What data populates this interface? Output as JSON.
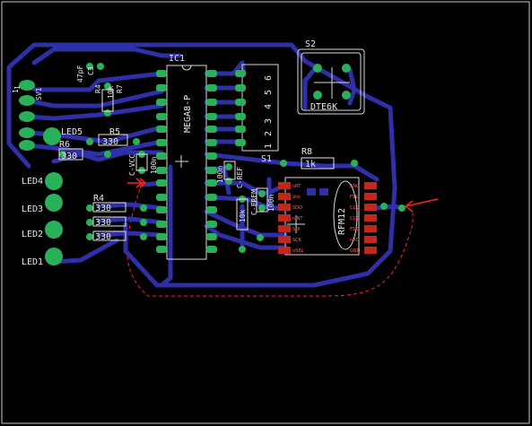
{
  "colors": {
    "background": "#000000",
    "outline": "#c8c8c8",
    "trace": "#2f2fa8",
    "pad": "#2bb05a",
    "silk": "#e6e6e6",
    "smd": "#c0281c",
    "marker": "#ff2020",
    "ratsnest": "#ff2020"
  },
  "labels": {
    "ic1": "IC1",
    "mega": "MEGA8-P",
    "sv1": "SV1",
    "cap47": "47pF",
    "c3": "C3",
    "r7": "R7",
    "r7v": "10k",
    "r4": "R4",
    "r4v": "R4",
    "led5": "LED5",
    "led4": "LED4",
    "led3": "LED3",
    "led2": "LED2",
    "led1": "LED1",
    "r6": "R6",
    "r6v": "330",
    "r5": "R5",
    "r5v": "330",
    "r3v": "330",
    "r2v": "330",
    "r1v": "330",
    "cvcc": "C-VCC",
    "c100n1": "100n",
    "c100n2": "100n",
    "c100n3": "100n",
    "cref": "C-REF",
    "cfrem": "C-FREM",
    "r10k": "10k",
    "s1": "S1",
    "s2": "S2",
    "dte6k": "DTE6K",
    "r8": "R8",
    "r8v": "1k",
    "rfm12": "RFM12",
    "one": "1",
    "sv_pin": "1",
    "dip": [
      "6",
      "5",
      "4",
      "3",
      "2",
      "1"
    ],
    "rfm_left": [
      "nRT",
      "Vcc",
      "SDO",
      "nINT",
      "SDI",
      "SCK",
      "nSEL"
    ],
    "rfm_right": [
      "ANG",
      "FSK",
      "CLK",
      "CLK",
      "FSK",
      "nRO",
      "GND"
    ]
  }
}
